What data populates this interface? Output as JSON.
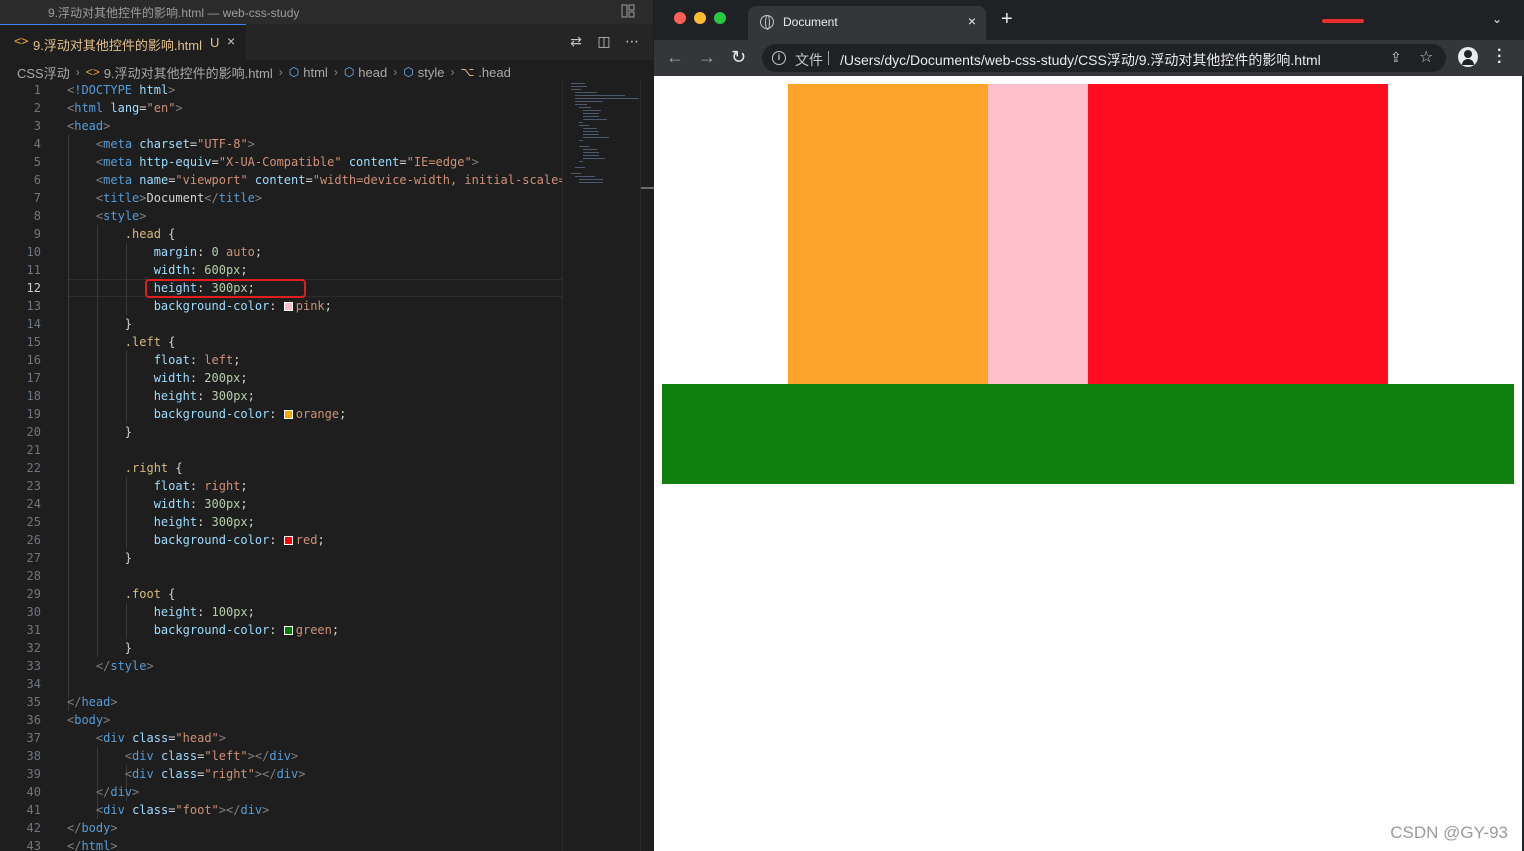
{
  "vscode": {
    "window_title": "9.浮动对其他控件的影响.html — web-css-study",
    "tab": {
      "icon": "html-icon",
      "name": "9.浮动对其他控件的影响.html",
      "status": "U",
      "close": "×"
    },
    "tab_actions": [
      "compare-icon",
      "split-editor-icon",
      "more-icon"
    ],
    "breadcrumb": [
      "CSS浮动",
      "9.浮动对其他控件的影响.html",
      "html",
      "head",
      "style",
      ".head"
    ],
    "active_line": 12
  },
  "browser": {
    "tab_title": "Document",
    "tab_close": "×",
    "new_tab": "+",
    "url_scheme": "文件",
    "url": "/Users/dyc/Documents/web-css-study/CSS浮动/9.浮动对其他控件的影响.html",
    "colors": {
      "orange": "#ffa42b",
      "pink": "#ffc0cb",
      "red": "#ff0e1f",
      "green": "#10800d"
    }
  },
  "watermark": "CSDN @GY-93"
}
